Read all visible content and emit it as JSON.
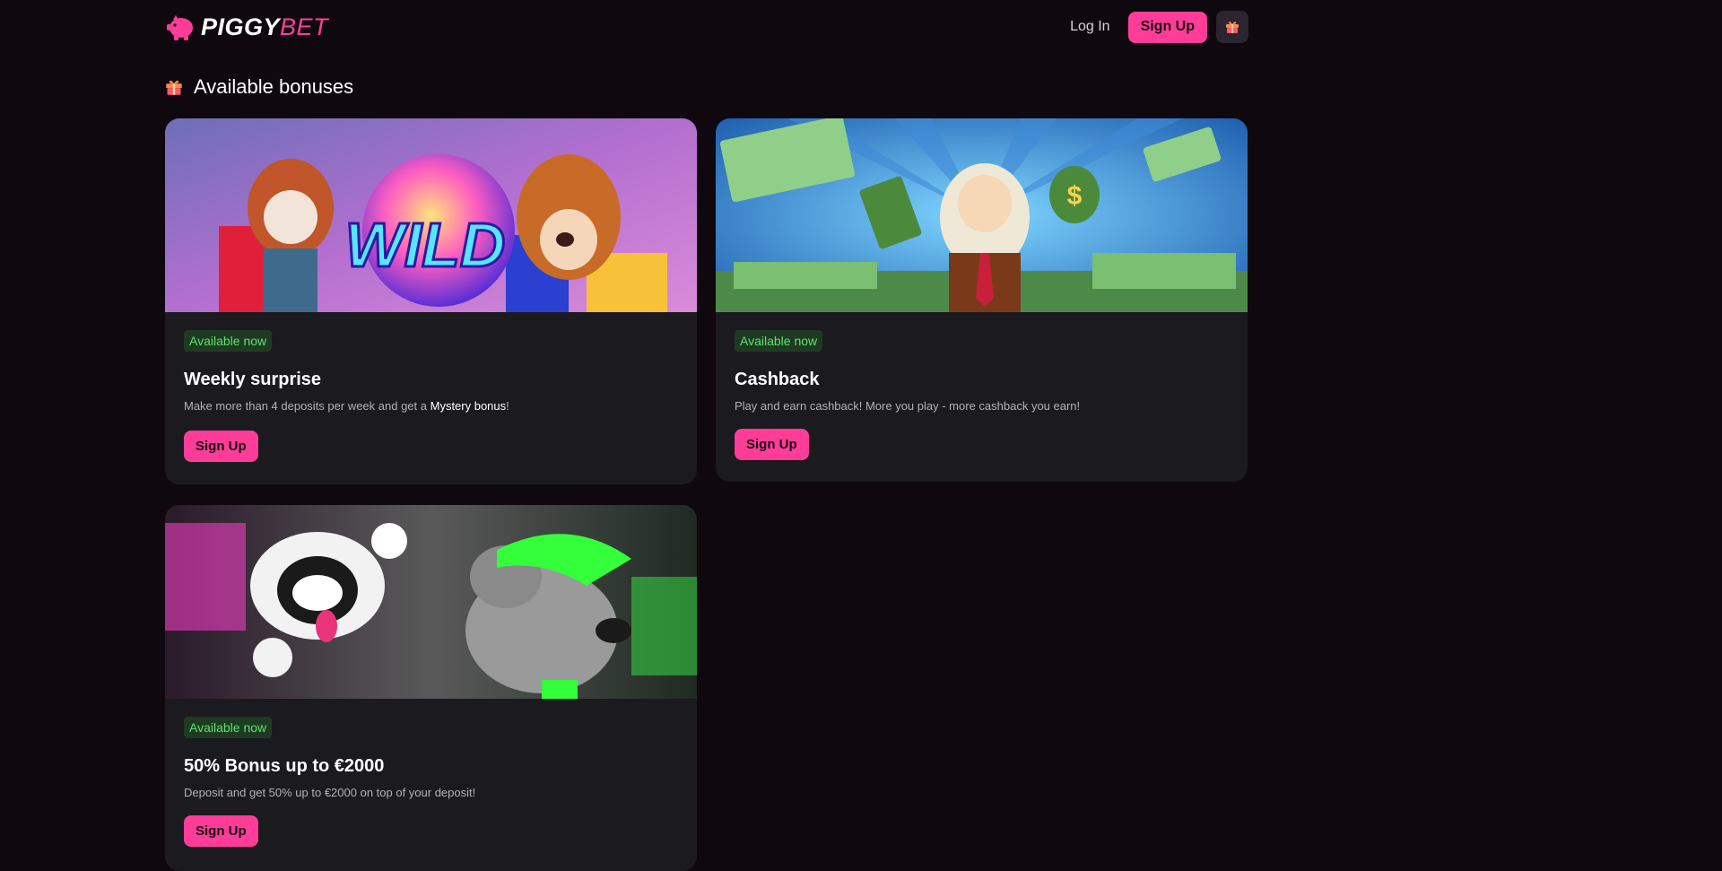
{
  "brand": {
    "name_part1": "PIGGY",
    "name_part2": "BET",
    "accent": "#ff3d98"
  },
  "header": {
    "login_label": "Log In",
    "signup_label": "Sign Up",
    "gift_icon": "gift-icon"
  },
  "section": {
    "title": "Available bonuses",
    "icon": "gift-icon"
  },
  "cards": [
    {
      "badge": "Available now",
      "title": "Weekly surprise",
      "desc_prefix": "Make more than 4 deposits per week and get a ",
      "desc_strong": "Mystery bonus",
      "desc_suffix": "!",
      "button": "Sign Up",
      "banner_text": "WILD"
    },
    {
      "badge": "Available now",
      "title": "Cashback",
      "desc": "Play and earn cashback! More you play - more cashback you earn!",
      "button": "Sign Up"
    },
    {
      "badge": "Available now",
      "title": "50% Bonus up to €2000",
      "desc": "Deposit and get 50% up to €2000 on top of your deposit!",
      "button": "Sign Up"
    }
  ],
  "colors": {
    "badge_bg": "#1f3a23",
    "badge_text": "#5ee16f",
    "card_bg": "#1a1a1f",
    "page_bg": "#0f090f"
  }
}
